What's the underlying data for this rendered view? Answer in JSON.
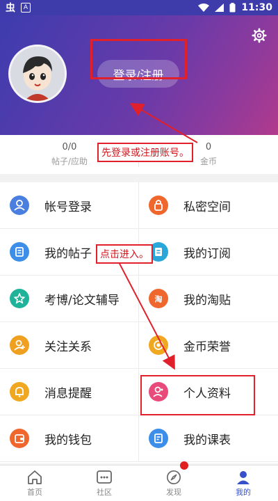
{
  "status_bar": {
    "time": "11:30",
    "carrier_icon": "虫",
    "app_icon_letter": "A"
  },
  "header": {
    "login_button": "登录/注册"
  },
  "stats": [
    {
      "value": "0/0",
      "label": "帖子/应助"
    },
    {
      "value": "0",
      "label": "金币"
    }
  ],
  "menu": [
    {
      "label": "帐号登录",
      "color": "#4a7fe0",
      "icon": "user-icon"
    },
    {
      "label": "私密空间",
      "color": "#f0672e",
      "icon": "lock-icon"
    },
    {
      "label": "我的帖子",
      "color": "#3c8ee8",
      "icon": "post-icon"
    },
    {
      "label": "我的订阅",
      "color": "#2aa6d8",
      "icon": "subscribe-icon"
    },
    {
      "label": "考博/论文辅导",
      "color": "#1fb39a",
      "icon": "star-icon"
    },
    {
      "label": "我的淘贴",
      "color": "#f0672e",
      "icon": "tao-icon"
    },
    {
      "label": "关注关系",
      "color": "#f0a020",
      "icon": "follow-icon"
    },
    {
      "label": "金币荣誉",
      "color": "#f0a820",
      "icon": "coin-icon"
    },
    {
      "label": "消息提醒",
      "color": "#f0a820",
      "icon": "bell-icon"
    },
    {
      "label": "个人资料",
      "color": "#e84a7a",
      "icon": "profile-icon"
    },
    {
      "label": "我的钱包",
      "color": "#f0672e",
      "icon": "wallet-icon"
    },
    {
      "label": "我的课表",
      "color": "#3c8ee8",
      "icon": "schedule-icon"
    }
  ],
  "bottom_nav": [
    {
      "label": "首页",
      "icon": "home-icon"
    },
    {
      "label": "社区",
      "icon": "community-icon"
    },
    {
      "label": "发现",
      "icon": "compass-icon"
    },
    {
      "label": "我的",
      "icon": "me-icon"
    }
  ],
  "annotations": {
    "note_login": "先登录或注册账号。",
    "note_enter": "点击进入。"
  },
  "colors": {
    "accent": "#3550c8",
    "annotation": "#e0202a"
  }
}
